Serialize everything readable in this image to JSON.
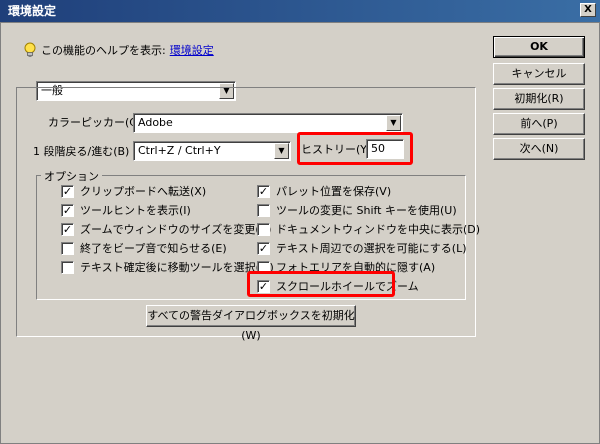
{
  "window": {
    "title": "環境設定",
    "close_label": "X"
  },
  "help": {
    "text": "この機能のヘルプを表示:",
    "link": "環境設定"
  },
  "section_select": {
    "value": "一般"
  },
  "color_picker": {
    "label": "カラーピッカー(C):",
    "value": "Adobe"
  },
  "undo": {
    "label": "1 段階戻る/進む(B)",
    "value": "Ctrl+Z / Ctrl+Y"
  },
  "history": {
    "label": "ヒストリー(Y):",
    "value": "50"
  },
  "options": {
    "caption": "オプション",
    "left": [
      {
        "label": "クリップボードへ転送(X)",
        "checked": true
      },
      {
        "label": "ツールヒントを表示(I)",
        "checked": true
      },
      {
        "label": "ズームでウィンドウのサイズを変更(Z)",
        "checked": true
      },
      {
        "label": "終了をビープ音で知らせる(E)",
        "checked": false
      },
      {
        "label": "テキスト確定後に移動ツールを選択(M)",
        "checked": false
      }
    ],
    "right": [
      {
        "label": "パレット位置を保存(V)",
        "checked": true
      },
      {
        "label": "ツールの変更に Shift キーを使用(U)",
        "checked": false
      },
      {
        "label": "ドキュメントウィンドウを中央に表示(D)",
        "checked": false
      },
      {
        "label": "テキスト周辺での選択を可能にする(L)",
        "checked": true
      },
      {
        "label": "フォトエリアを自動的に隠す(A)",
        "checked": false
      },
      {
        "label": "スクロールホイールでズーム",
        "checked": true
      }
    ]
  },
  "reset_warnings_label": "すべての警告ダイアログボックスを初期化(W)",
  "buttons": {
    "ok": "OK",
    "cancel": "キャンセル",
    "reset": "初期化(R)",
    "prev": "前へ(P)",
    "next": "次へ(N)"
  },
  "colors": {
    "highlight": "#ff0000",
    "link": "#0000cc",
    "titlebar": "#1f3f7a"
  }
}
